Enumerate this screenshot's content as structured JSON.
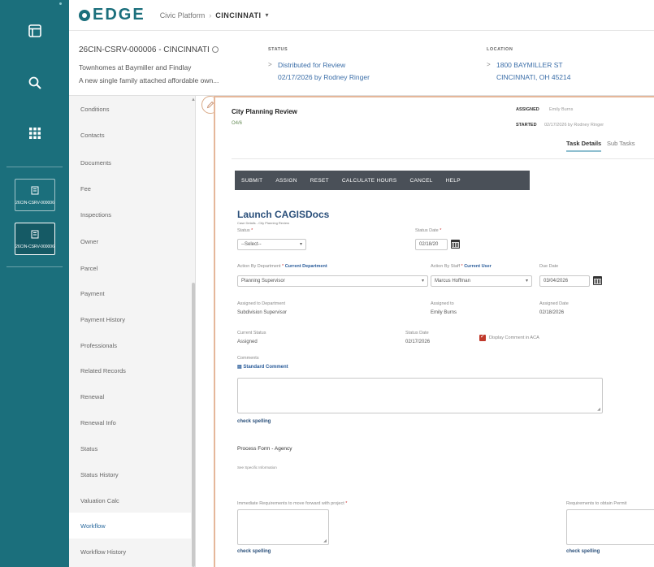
{
  "app": {
    "name": "EDGE",
    "breadcrumb_root": "Civic Platform",
    "breadcrumb_current": "CINCINNATI"
  },
  "rail": {
    "items": [
      {
        "icon": "window-icon"
      },
      {
        "icon": "search-icon"
      },
      {
        "icon": "grid-icon"
      }
    ],
    "records": [
      {
        "icon": "building-icon",
        "label": "26CIN-CSRV-000006"
      },
      {
        "icon": "building-icon",
        "label": "26CIN-CSRV-000006"
      }
    ]
  },
  "record": {
    "id": "26CIN-CSRV-000006 - CINCINNATI",
    "line2": "Townhomes at Baymiller and Findlay",
    "line3": "A new single family attached affordable own...",
    "status_label": "STATUS",
    "status_value": "Distributed for Review",
    "status_sub": "02/17/2026 by Rodney Ringer",
    "location_label": "LOCATION",
    "location_line1": "1800 BAYMILLER ST",
    "location_line2": "CINCINNATI, OH 45214"
  },
  "sidebar": {
    "items": [
      "Conditions",
      "Contacts",
      "Documents",
      "Fee",
      "Inspections",
      "Owner",
      "Parcel",
      "Payment",
      "Payment History",
      "Professionals",
      "Related Records",
      "Renewal",
      "Renewal Info",
      "Status",
      "Status History",
      "Valuation Calc",
      "Workflow",
      "Workflow History"
    ],
    "active_index": 16
  },
  "task": {
    "title": "City Planning Review",
    "subtitle": "O4/6",
    "assigned_label": "ASSIGNED",
    "assigned_value": "Emily Burns",
    "started_label": "STARTED",
    "started_value": "02/17/2026 by Rodney Ringer",
    "tabs": [
      "Task Details",
      "Sub Tasks"
    ],
    "toolbar": [
      "SUBMIT",
      "ASSIGN",
      "RESET",
      "CALCULATE HOURS",
      "CANCEL",
      "HELP"
    ],
    "launch_title": "Launch CAGISDocs",
    "launch_sub": "Case Details - City Planning Review"
  },
  "form": {
    "status_label": "Status",
    "status_value": "--Select--",
    "status_date_label": "Status Date",
    "status_date_value": "02/18/20",
    "action_dept_label": "Action By Department",
    "current_department_link": "Current Department",
    "action_dept_value": "Planning Supervisor",
    "action_staff_label": "Action By Staff",
    "current_user_link": "Current User",
    "action_staff_value": "Marcus Hoffman",
    "due_date_label": "Due Date",
    "due_date_value": "03/04/2026",
    "assigned_dept_label": "Assigned to Department",
    "assigned_dept_value": "Subdivision Supervisor",
    "assigned_to_label": "Assigned to",
    "assigned_to_value": "Emily Burns",
    "assigned_date_label": "Assigned Date",
    "assigned_date_value": "02/18/2026",
    "current_status_label": "Current Status",
    "current_status_value": "Assigned",
    "current_status_date_label": "Status Date",
    "current_status_date_value": "02/17/2026",
    "display_comment_label": "Display Comment in ACA",
    "comments_label": "Comments",
    "standard_comment": "Standard Comment",
    "check_spelling": "check spelling",
    "process_form_title": "Process Form - Agency",
    "process_form_sub": "See Specific Information",
    "immediate_req_label": "Immediate Requirements to move forward with project",
    "requirements_obtain_label": "Requirements to obtain Permit"
  }
}
